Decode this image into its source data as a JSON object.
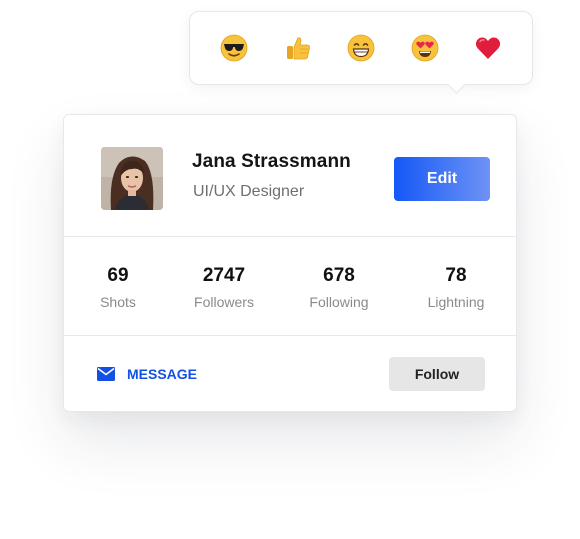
{
  "reactions": [
    {
      "icon": "sunglasses-emoji-icon"
    },
    {
      "icon": "thumbs-up-emoji-icon"
    },
    {
      "icon": "grinning-emoji-icon"
    },
    {
      "icon": "heart-eyes-emoji-icon"
    },
    {
      "icon": "red-heart-emoji-icon"
    }
  ],
  "profile": {
    "name": "Jana Strassmann",
    "role": "UI/UX Designer",
    "edit_label": "Edit",
    "avatar_icon": "avatar-photo"
  },
  "stats": [
    {
      "value": "69",
      "label": "Shots"
    },
    {
      "value": "2747",
      "label": "Followers"
    },
    {
      "value": "678",
      "label": "Following"
    },
    {
      "value": "78",
      "label": "Lightning"
    }
  ],
  "footer": {
    "message_label": "MESSAGE",
    "message_icon": "envelope-icon",
    "follow_label": "Follow"
  },
  "colors": {
    "accent": "#1450e6",
    "edit_gradient_start": "#1458f7",
    "edit_gradient_end": "#6f93f5",
    "follow_bg": "#e6e6e6"
  }
}
